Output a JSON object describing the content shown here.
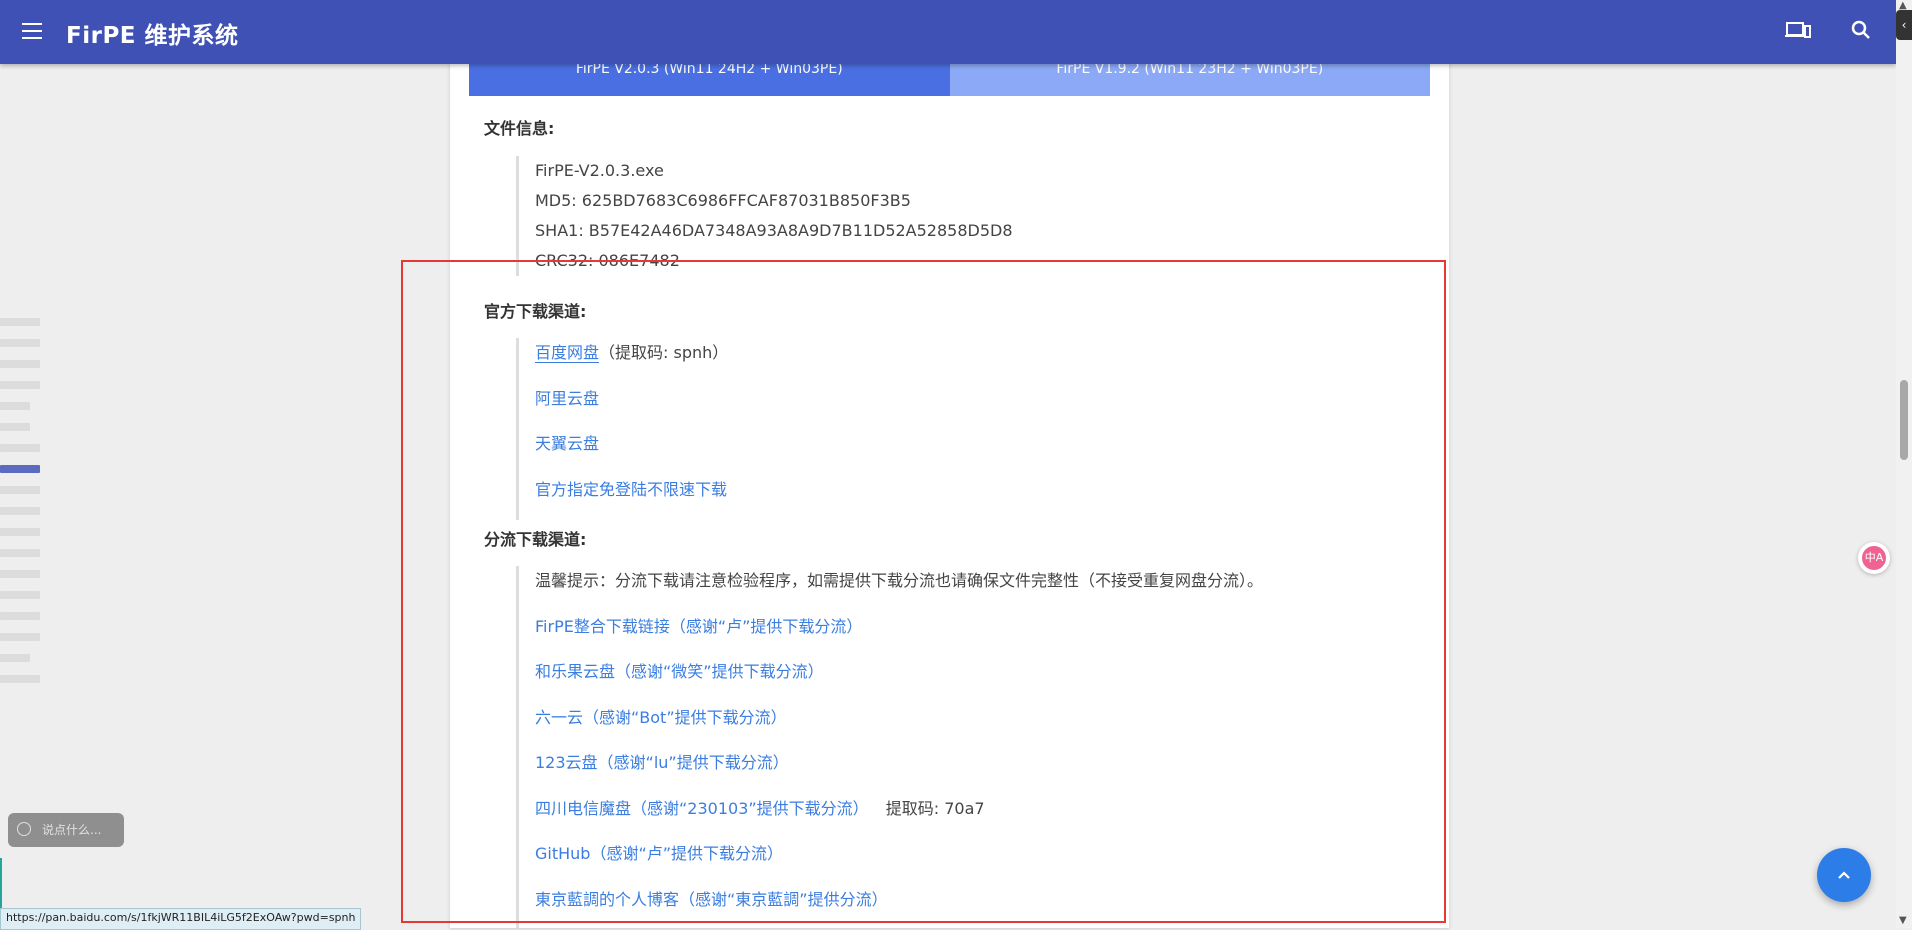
{
  "appbar": {
    "title": "FirPE 维护系统",
    "menu_icon": "menu-icon",
    "device_icon": "devices-icon",
    "search_icon": "search-icon",
    "color": "#3f51b5"
  },
  "tabs": [
    {
      "label": "FirPE V2.0.3 (Win11 24H2 + Win03PE)",
      "active": true
    },
    {
      "label": "FirPE V1.9.2 (Win11 23H2 + Win03PE)",
      "active": false
    }
  ],
  "file_info": {
    "heading": "文件信息:",
    "lines": [
      "FirPE-V2.0.3.exe",
      "MD5: 625BD7683C6986FFCAF87031B850F3B5",
      "SHA1: B57E42A46DA7348A93A8A9D7B11D52A52858D5D8",
      "CRC32: 086E7482"
    ]
  },
  "official": {
    "heading": "官方下载渠道:",
    "links": [
      {
        "label": "百度网盘",
        "suffix": "（提取码: spnh）"
      },
      {
        "label": "阿里云盘",
        "suffix": ""
      },
      {
        "label": "天翼云盘",
        "suffix": ""
      },
      {
        "label": "官方指定免登陆不限速下载",
        "suffix": ""
      }
    ]
  },
  "mirror": {
    "heading": "分流下载渠道:",
    "note": "温馨提示：分流下载请注意检验程序，如需提供下载分流也请确保文件完整性（不接受重复网盘分流）。",
    "links": [
      {
        "label": "FirPE整合下载链接（感谢“卢”提供下载分流）",
        "suffix": ""
      },
      {
        "label": "和乐果云盘（感谢“微笑”提供下载分流）",
        "suffix": ""
      },
      {
        "label": "六一云（感谢“Bot”提供下载分流）",
        "suffix": ""
      },
      {
        "label": "123云盘（感谢“lu”提供下载分流）",
        "suffix": ""
      },
      {
        "label": "四川电信魔盘（感谢“230103”提供下载分流）",
        "suffix": "提取码: 70a7"
      },
      {
        "label": "GitHub（感谢“卢”提供下载分流）",
        "suffix": ""
      },
      {
        "label": "東京藍調的个人博客（感谢“東京藍調”提供分流）",
        "suffix": ""
      }
    ]
  },
  "comment": {
    "placeholder": "说点什么...",
    "icon": "smile-icon"
  },
  "status_url": "https://pan.baidu.com/s/1fkjWR11BIL4iLG5f2ExOAw?pwd=spnh",
  "fab": {
    "icon": "chevron-up-icon"
  },
  "translate": {
    "icon": "translate-icon",
    "label": "中A"
  },
  "side_toggle": {
    "icon": "chevron-left-icon",
    "label": "‹"
  },
  "colors": {
    "link": "#3b7ee0",
    "annotation": "#e53935",
    "tab_active": "#4a6fe3",
    "tab_inactive": "#8ba9f6"
  }
}
